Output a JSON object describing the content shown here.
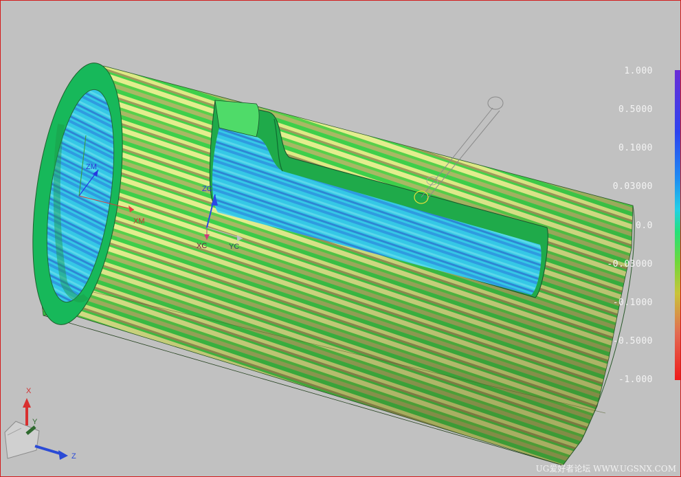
{
  "colors": {
    "background": "#c1c1c1",
    "viewport_border": "#d21a1a",
    "surface_green": "#3ecf4a",
    "surface_yellow": "#d8ea7e",
    "surface_olive": "#9e9a5a",
    "inner_cyan": "#35c8e6",
    "inner_blue": "#2f8fd6",
    "rim_green": "#17b85a",
    "legend_text": "#f4f4f4"
  },
  "csys": {
    "work": {
      "z_label": "ZM",
      "x_label": "XM"
    },
    "current": {
      "z_label": "ZC",
      "x_label": "XC",
      "y_label": "YC"
    },
    "view_triad": {
      "x_label": "X",
      "y_label": "Y",
      "z_label": "Z"
    }
  },
  "legend": {
    "labels": [
      "1.000",
      "0.5000",
      "0.1000",
      "0.03000",
      "0.0",
      "-0.03000",
      "-0.1000",
      "-0.5000",
      "-1.000"
    ],
    "colors": [
      "#6a2ed6",
      "#2d43ef",
      "#1f8cf2",
      "#22d0e6",
      "#24e07a",
      "#6fd83b",
      "#c9c43a",
      "#e36a52",
      "#ef1b1b"
    ]
  },
  "watermark": "UG爱好者论坛 WWW.UGSNX.COM"
}
